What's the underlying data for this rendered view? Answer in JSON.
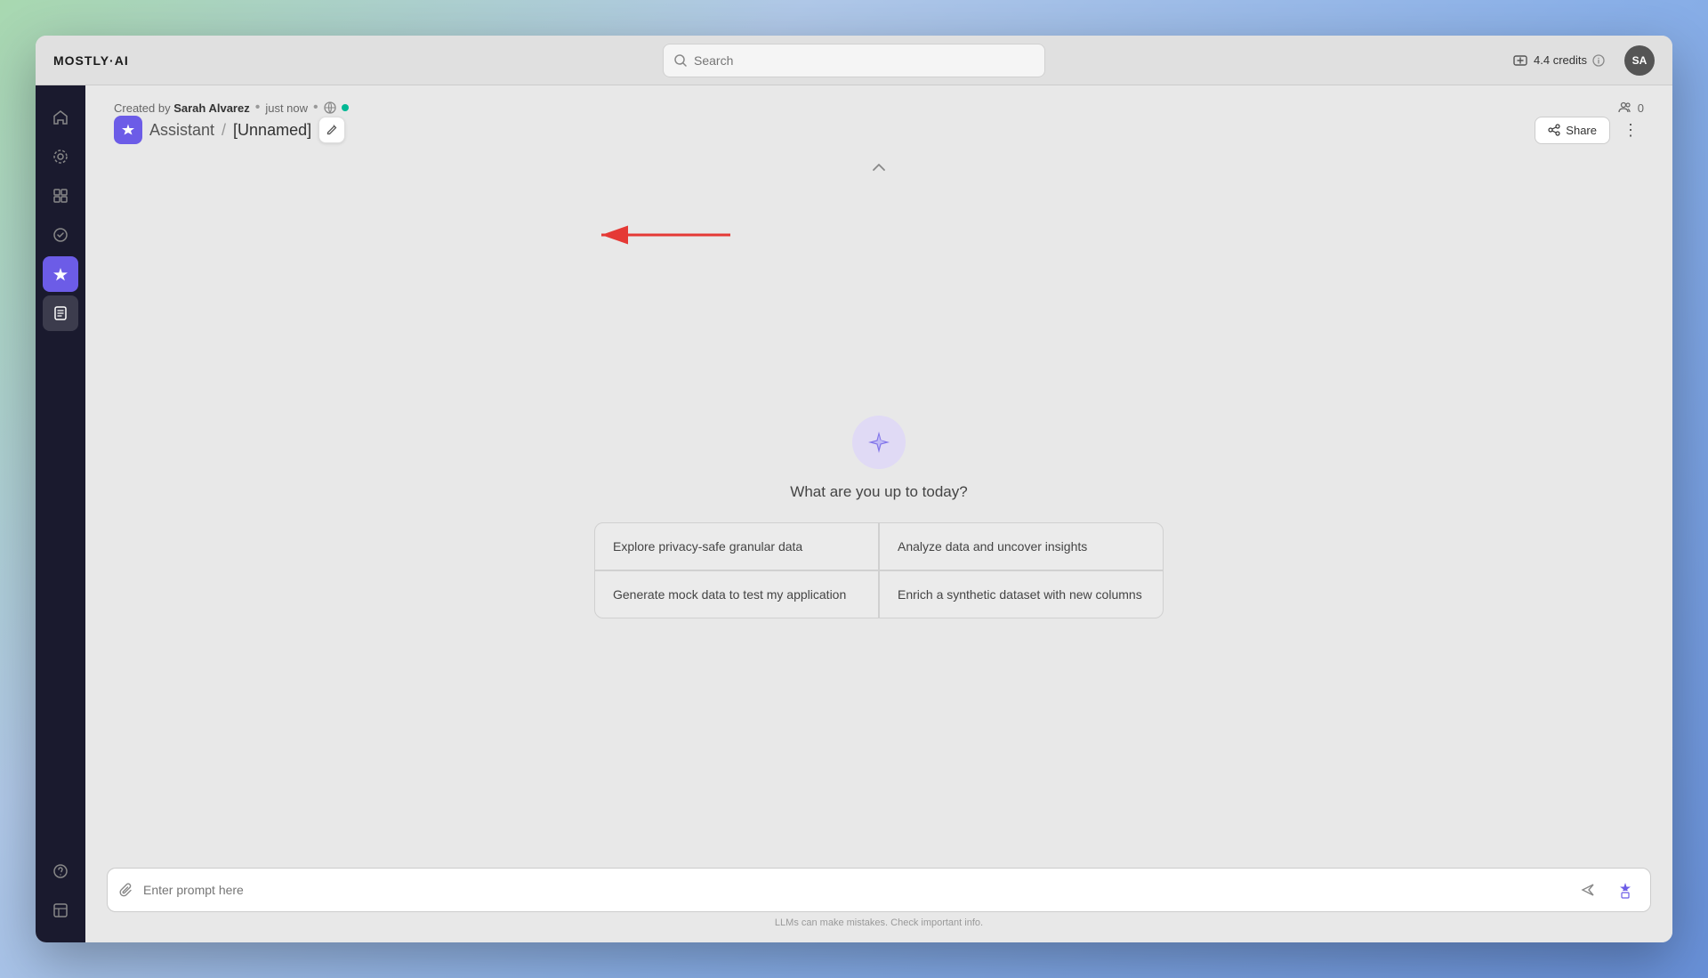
{
  "app": {
    "logo": "MOSTLY·AI"
  },
  "header": {
    "search_placeholder": "Search",
    "credits_label": "4.4 credits",
    "avatar_initials": "SA"
  },
  "page": {
    "created_by": "Sarah Alvarez",
    "created_time": "just now",
    "users_count": "0",
    "breadcrumb_parent": "Assistant",
    "breadcrumb_separator": "/",
    "breadcrumb_current": "[Unnamed]",
    "share_label": "Share",
    "what_today": "What are you up to today?"
  },
  "suggestions": [
    {
      "id": 1,
      "text": "Explore privacy-safe granular data"
    },
    {
      "id": 2,
      "text": "Analyze data and uncover insights"
    },
    {
      "id": 3,
      "text": "Generate mock data to test my application"
    },
    {
      "id": 4,
      "text": "Enrich a synthetic dataset with new columns"
    }
  ],
  "input": {
    "placeholder": "Enter prompt here",
    "disclaimer": "LLMs can make mistakes. Check important info."
  },
  "sidebar": {
    "items": [
      {
        "id": "home",
        "label": "Home",
        "active": false
      },
      {
        "id": "models",
        "label": "Models",
        "active": false
      },
      {
        "id": "datasets",
        "label": "Datasets",
        "active": false
      },
      {
        "id": "connectors",
        "label": "Connectors",
        "active": false
      },
      {
        "id": "assistant",
        "label": "Assistant",
        "active": true
      },
      {
        "id": "notebooks",
        "label": "Notebooks",
        "active": false
      }
    ]
  }
}
